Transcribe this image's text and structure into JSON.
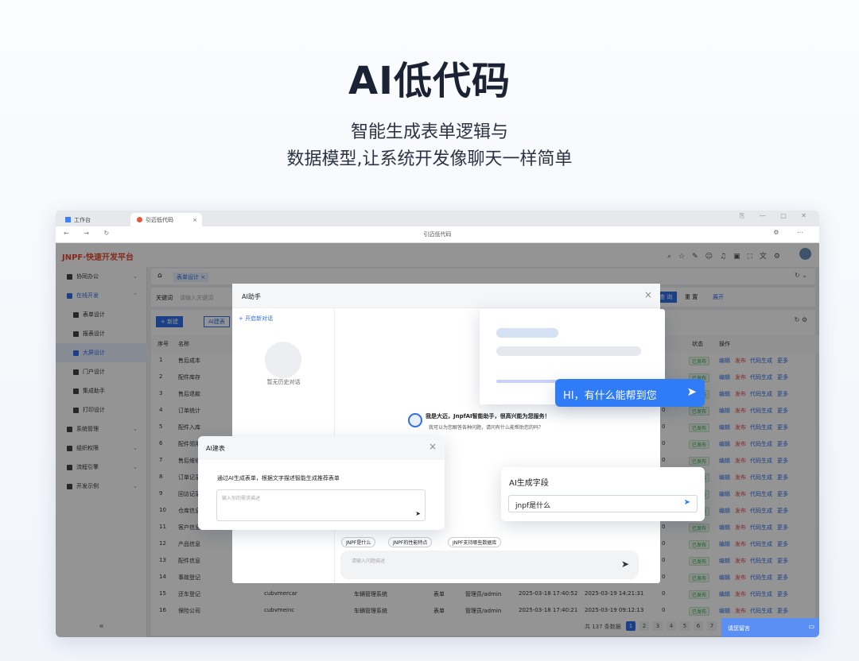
{
  "hero": {
    "title": "AI低代码",
    "subtitle_1": "智能生成表单逻辑与",
    "subtitle_2": "数据模型,让系统开发像聊天一样简单"
  },
  "browser": {
    "tab1": "工作台",
    "tab2": "引迈低代码",
    "address": "引迈低代码"
  },
  "app": {
    "logo": "JNPF·快速开发平台"
  },
  "sidebar": {
    "items": [
      {
        "label": "协同办公",
        "chev": "⌄"
      },
      {
        "label": "在线开发",
        "chev": "⌃"
      },
      {
        "label": "表单设计"
      },
      {
        "label": "报表设计"
      },
      {
        "label": "大屏设计"
      },
      {
        "label": "门户设计"
      },
      {
        "label": "集成助手"
      },
      {
        "label": "打印设计"
      },
      {
        "label": "系统管理",
        "chev": "⌄"
      },
      {
        "label": "组织权限",
        "chev": "⌄"
      },
      {
        "label": "流程引擎",
        "chev": "⌄"
      },
      {
        "label": "开发示例",
        "chev": "⌄"
      }
    ],
    "collapse": "«"
  },
  "content": {
    "breadcrumb": "表单设计 ×",
    "keyword_label": "关键词",
    "keyword_placeholder": "请输入关键词",
    "query": "查 询",
    "reset": "重 置",
    "expand": "展开",
    "new_btn": "+ 新建",
    "ai_btn": "AI建表",
    "headers": {
      "idx": "序号",
      "name": "名称",
      "status": "状态",
      "ops": "操作"
    },
    "ops": {
      "edit": "编辑",
      "publish": "发布",
      "gen": "代码生成",
      "more": "更多"
    },
    "status_text": "已发布",
    "rows": [
      {
        "n": "1",
        "name": "售后成本",
        "c": "0"
      },
      {
        "n": "2",
        "name": "配件库存",
        "c": "0"
      },
      {
        "n": "3",
        "name": "售后退款",
        "c": "0"
      },
      {
        "n": "4",
        "name": "订单统计",
        "c": "0"
      },
      {
        "n": "5",
        "name": "配件入库",
        "c": "0"
      },
      {
        "n": "6",
        "name": "配件领用",
        "c": "0"
      },
      {
        "n": "7",
        "name": "售后维修",
        "c": "0"
      },
      {
        "n": "8",
        "name": "订单记录",
        "c": "0"
      },
      {
        "n": "9",
        "name": "回访记录",
        "c": "0"
      },
      {
        "n": "10",
        "name": "仓库信息",
        "c": "0"
      },
      {
        "n": "11",
        "name": "客户信息",
        "c": "0"
      },
      {
        "n": "12",
        "name": "产品信息",
        "c": "0"
      },
      {
        "n": "13",
        "name": "配件信息",
        "c": "0"
      },
      {
        "n": "14",
        "name": "事故登记",
        "c": "0"
      },
      {
        "n": "15",
        "name": "还车登记",
        "code": "cubvmercar",
        "cat": "车辆管理系统",
        "type": "表单",
        "user": "管理员/admin",
        "t1": "2025-03-18 17:40:52",
        "t2": "2025-03-19 14:21:31",
        "c": "0"
      },
      {
        "n": "16",
        "name": "保险公司",
        "code": "cubvmeinc",
        "cat": "车辆管理系统",
        "type": "表单",
        "user": "管理员/admin",
        "t1": "2025-03-18 17:40:21",
        "t2": "2025-03-19 09:12:13",
        "c": "0"
      }
    ],
    "total": "共 137 条数据",
    "pages": [
      "1",
      "2",
      "3",
      "4",
      "5",
      "6",
      "7"
    ],
    "chat_widget": "请您留言"
  },
  "assistant": {
    "title": "AI助手",
    "new_chat": "+ 开启新对话",
    "empty_history": "暂无历史对话",
    "welcome": "我是大迈，JnpfAI智能助手，很高兴能为您服务！",
    "welcome_sub": "我可以为您解答各种问题，请问有什么能帮助您的吗？",
    "chips": [
      "JNPF是什么",
      "JNPF的性能特点",
      "JNPF支持哪些数据库"
    ],
    "input_placeholder": "请输入问题描述"
  },
  "ai_table": {
    "title": "AI建表",
    "desc": "通过AI生成表单，根据文字描述智能生成推荐表单",
    "placeholder": "输入你的需求描述"
  },
  "hi_bubble": {
    "text": "HI，有什么能帮到您"
  },
  "ai_field": {
    "title": "AI生成字段",
    "input": "jnpf是什么"
  },
  "colors": {
    "primary": "#2f6fe8",
    "bubble": "#2f7cf6",
    "heading": "#1a2233"
  }
}
